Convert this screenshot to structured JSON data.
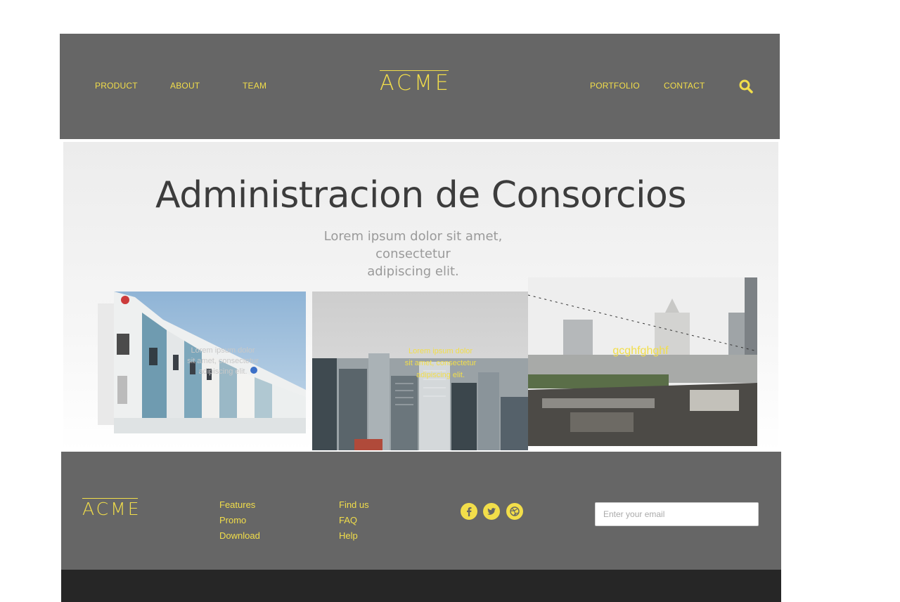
{
  "header": {
    "nav_left": [
      "PRODUCT",
      "ABOUT",
      "TEAM"
    ],
    "logo": "ACME",
    "nav_right": [
      "PORTFOLIO",
      "CONTACT"
    ],
    "search_icon": "search-icon"
  },
  "hero": {
    "title": "Administracion de Consorcios",
    "subtitle_lines": [
      "Lorem ipsum dolor sit amet,",
      "consectetur",
      "adipiscing elit."
    ],
    "cards": [
      {
        "caption_lines": [
          "Lorem ipsum dolor",
          "sit amet, consectetur",
          "adipiscing elit."
        ],
        "caption_color": "#c8c8c8"
      },
      {
        "caption_lines": [
          "Lorem ipsum dolor",
          "sit amet, consectetur",
          "adipiscing elit."
        ],
        "caption_color": "#f2de4a"
      },
      {
        "caption_lines": [
          "gcghfghghf"
        ],
        "caption_color": "#f2de4a"
      }
    ]
  },
  "footer": {
    "logo": "ACME",
    "links_col1": [
      "Features",
      "Promo",
      "Download"
    ],
    "links_col2": [
      "Find us",
      "FAQ",
      "Help"
    ],
    "social": [
      "facebook-icon",
      "twitter-icon",
      "dribbble-icon"
    ],
    "email_placeholder": "Enter your email"
  },
  "colors": {
    "accent": "#f2de4a",
    "header_bg": "#666666",
    "footer_bottom_bg": "#262626"
  }
}
